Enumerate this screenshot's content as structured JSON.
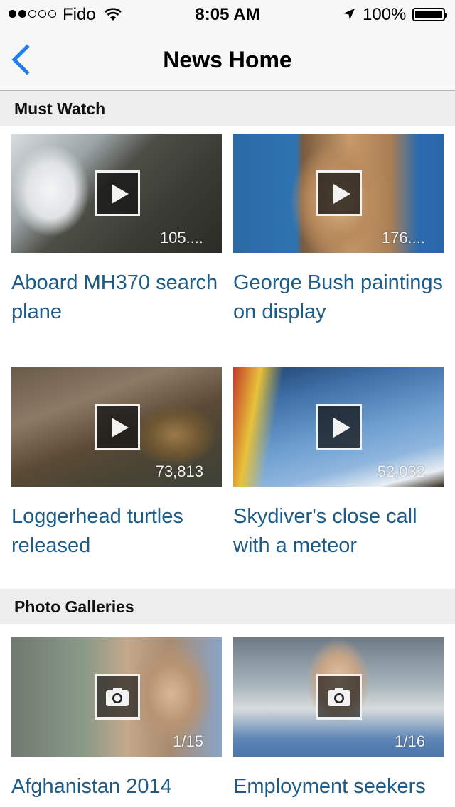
{
  "status_bar": {
    "carrier": "Fido",
    "signal_bars_filled": 2,
    "signal_bars_total": 5,
    "time": "8:05 AM",
    "battery": "100%"
  },
  "nav": {
    "title": "News Home",
    "back_icon": "chevron-left-icon"
  },
  "colors": {
    "accent": "#1d7ef0",
    "link_text": "#1d5b88",
    "section_bg": "#ededed"
  },
  "sections": [
    {
      "title": "Must Watch",
      "items": [
        {
          "title": "Aboard MH370 search plane",
          "count": "105....",
          "icon": "play-icon"
        },
        {
          "title": "George Bush paintings on display",
          "count": "176....",
          "icon": "play-icon"
        },
        {
          "title": "Loggerhead turtles released",
          "count": "73,813",
          "icon": "play-icon"
        },
        {
          "title": "Skydiver's close call with a meteor",
          "count": "52,032",
          "icon": "play-icon"
        }
      ]
    },
    {
      "title": "Photo Galleries",
      "items": [
        {
          "title": "Afghanistan 2014",
          "count": "1/15",
          "icon": "camera-icon"
        },
        {
          "title": "Employment seekers",
          "count": "1/16",
          "icon": "camera-icon"
        }
      ]
    }
  ]
}
